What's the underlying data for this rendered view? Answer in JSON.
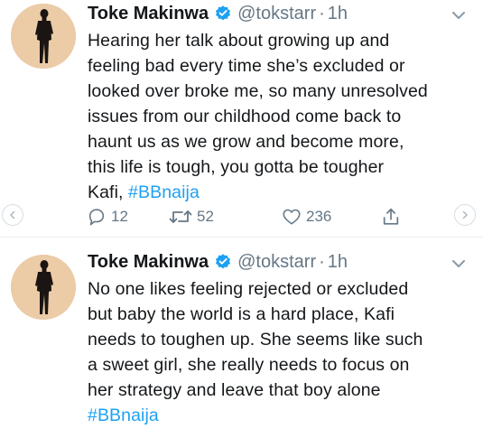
{
  "tweets": [
    {
      "display_name": "Toke Makinwa",
      "handle": "@tokstarr",
      "separator": "·",
      "time": "1h",
      "text_lines": [
        "Hearing her talk about growing up and",
        "feeling bad every time she’s excluded or",
        "looked over broke me, so many unresolved",
        "issues from our childhood come back to",
        "haunt us as we grow and become more,",
        "this life is tough, you gotta be tougher"
      ],
      "last_line_prefix": "Kafi, ",
      "hashtag": "#BBnaija",
      "reply_count": "12",
      "retweet_count": "52",
      "like_count": "236"
    },
    {
      "display_name": "Toke Makinwa",
      "handle": "@tokstarr",
      "separator": "·",
      "time": "1h",
      "text_lines": [
        "No one likes feeling rejected or excluded",
        "but baby the world is a hard place, Kafi",
        "needs to toughen up. She seems like such",
        "a sweet girl, she really needs to focus on",
        "her strategy and leave that boy alone"
      ],
      "hashtag": "#BBnaija"
    }
  ],
  "icons": {
    "verified": "verified-badge-icon",
    "chevron": "chevron-down-icon",
    "reply": "reply-icon",
    "retweet": "retweet-icon",
    "like": "heart-icon",
    "share": "share-icon",
    "prev": "chevron-left-icon",
    "next": "chevron-right-icon"
  },
  "colors": {
    "text": "#14171a",
    "secondary": "#657786",
    "hashtag": "#1da1f2",
    "verified": "#1da1f2",
    "divider": "#e6ecf0",
    "avatar_bg": "#eccba7"
  }
}
